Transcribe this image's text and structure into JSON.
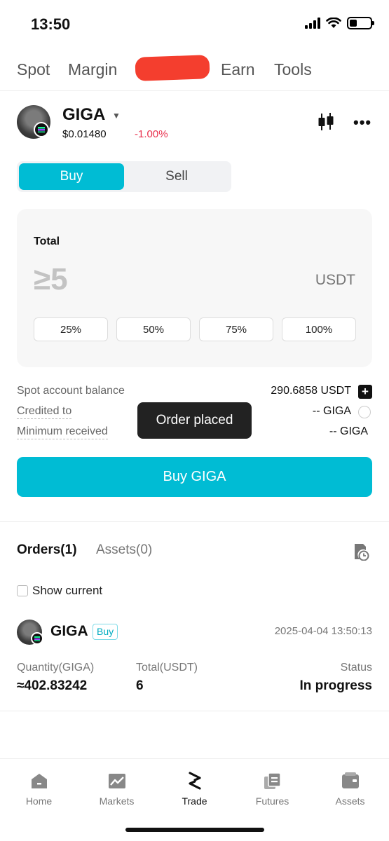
{
  "status_bar": {
    "time": "13:50"
  },
  "top_tabs": [
    "Spot",
    "Margin",
    "Earn",
    "Tools"
  ],
  "pair": {
    "symbol": "GIGA",
    "price": "$0.01480",
    "change": "-1.00%",
    "change_color": "#e8304d",
    "icons": [
      "chart-candles-icon",
      "more-icon"
    ]
  },
  "side_toggle": {
    "buy": "Buy",
    "sell": "Sell",
    "selected": "Buy",
    "accent": "#00bcd4"
  },
  "total": {
    "label": "Total",
    "placeholder": "≥5",
    "unit": "USDT",
    "percentages": [
      "25%",
      "50%",
      "75%",
      "100%"
    ]
  },
  "info": {
    "balance_label": "Spot account balance",
    "balance_value": "290.6858 USDT",
    "credited_label": "Credited to",
    "credited_value": "-- GIGA",
    "min_label": "Minimum received",
    "min_value": "-- GIGA"
  },
  "toast": "Order placed",
  "buy_button": "Buy GIGA",
  "orders": {
    "tab_orders": "Orders(1)",
    "tab_assets": "Assets(0)",
    "show_current": "Show current",
    "item": {
      "symbol": "GIGA",
      "side": "Buy",
      "time": "2025-04-04 13:50:13",
      "qty_label": "Quantity(GIGA)",
      "qty_value": "≈402.83242",
      "total_label": "Total(USDT)",
      "total_value": "6",
      "status_label": "Status",
      "status_value": "In progress"
    }
  },
  "bottom_nav": [
    {
      "label": "Home",
      "icon": "home-icon"
    },
    {
      "label": "Markets",
      "icon": "markets-icon"
    },
    {
      "label": "Trade",
      "icon": "trade-icon",
      "active": true
    },
    {
      "label": "Futures",
      "icon": "futures-icon"
    },
    {
      "label": "Assets",
      "icon": "wallet-icon"
    }
  ]
}
